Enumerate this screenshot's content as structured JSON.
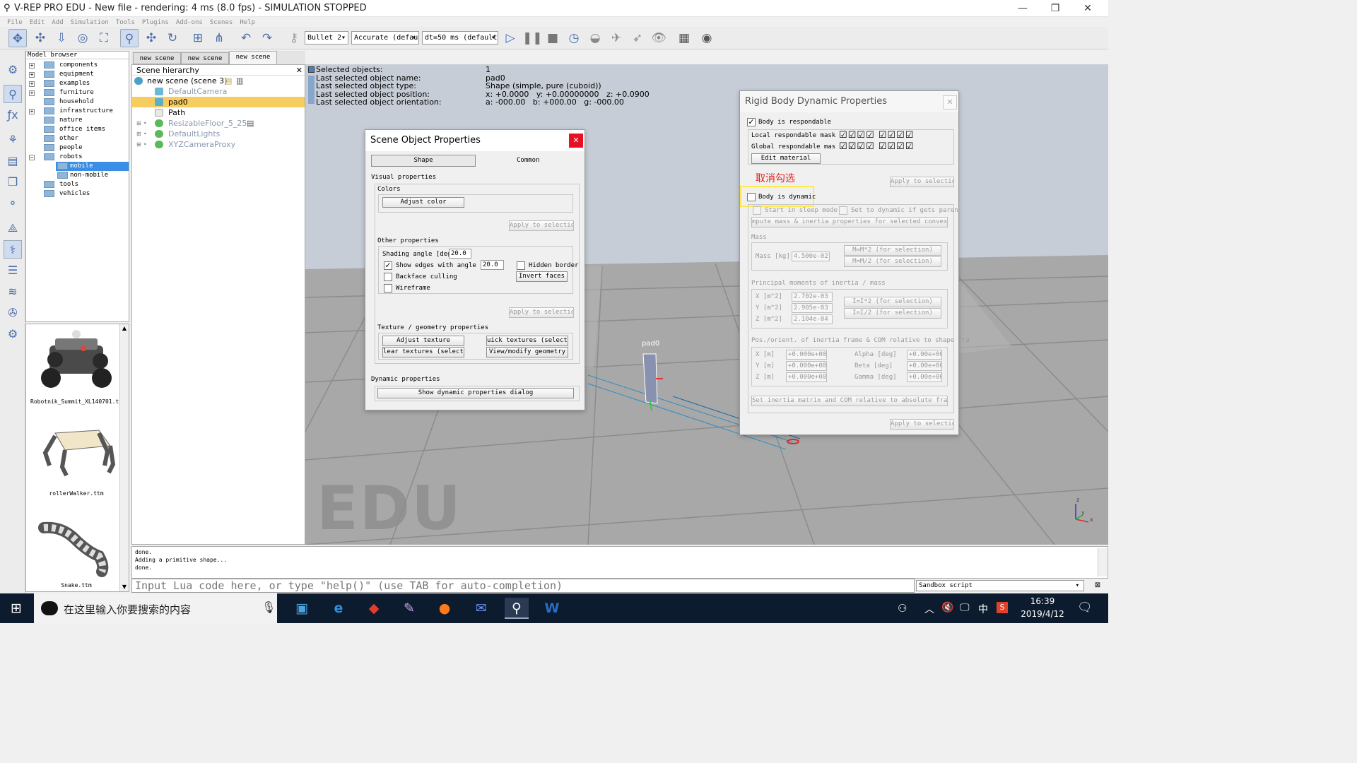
{
  "window": {
    "title": "V-REP PRO EDU - New file - rendering: 4 ms (8.0 fps) - SIMULATION STOPPED"
  },
  "menu": [
    "File",
    "Edit",
    "Add",
    "Simulation",
    "Tools",
    "Plugins",
    "Add-ons",
    "Scenes",
    "Help"
  ],
  "toolbar": {
    "engine": "Bullet 2",
    "accuracy": "Accurate (defau",
    "timestep": "dt=50 ms (default"
  },
  "model_browser": {
    "header": "Model browser",
    "items": [
      "components",
      "equipment",
      "examples",
      "furniture",
      "household",
      "infrastructure",
      "nature",
      "office items",
      "other",
      "people",
      "robots",
      "mobile",
      "non-mobile",
      "tools",
      "vehicles"
    ],
    "thumbnails": [
      "Robotnik_Summit_XL140701.ttm",
      "rollerWalker.ttm",
      "Snake.ttm"
    ]
  },
  "scene_tabs": [
    "new scene",
    "new scene",
    "new scene"
  ],
  "hierarchy": {
    "header": "Scene hierarchy",
    "root": "new scene (scene 3)",
    "items": [
      "DefaultCamera",
      "pad0",
      "Path",
      "ResizableFloor_5_25",
      "DefaultLights",
      "XYZCameraProxy"
    ]
  },
  "info": {
    "labels": [
      "Selected objects:",
      "Last selected object name:",
      "Last selected object type:",
      "Last selected object position:",
      "Last selected object orientation:"
    ],
    "values": [
      "1",
      "pad0",
      "Shape (simple, pure (cuboid))",
      "x: +0.0000   y: +0.00000000   z: +0.0900",
      "a: -000.00   b: +000.00   g: -000.00"
    ]
  },
  "viewport": {
    "watermark": "EDU",
    "object_label": "pad0",
    "axis_z": "z",
    "axis_x": "x",
    "axis_y": "y"
  },
  "sop": {
    "title": "Scene Object Properties",
    "tab_shape": "Shape",
    "tab_common": "Common",
    "visual_title": "Visual properties",
    "colors": "Colors",
    "adjust_color": "Adjust color",
    "apply1": "Apply to selection",
    "other_title": "Other properties",
    "shading_label": "Shading angle [deg]",
    "shading_value": "20.0",
    "show_edges": "Show edges with angle [de",
    "edges_value": "20.0",
    "hidden_border": "Hidden border",
    "backface": "Backface culling",
    "invert_faces": "Invert faces",
    "wireframe": "Wireframe",
    "apply2": "Apply to selection",
    "texture_title": "Texture / geometry properties",
    "adjust_texture": "Adjust texture",
    "quick_textures": "uick textures (selection",
    "clear_textures": "lear textures (selection",
    "view_geometry": "View/modify geometry",
    "dynamic_title": "Dynamic properties",
    "show_dynamic": "Show dynamic properties dialog"
  },
  "rbd": {
    "title": "Rigid Body Dynamic Properties",
    "respondable": "Body is respondable",
    "local_mask": "Local respondable mask",
    "global_mask": "Global respondable mas",
    "edit_material": "Edit material",
    "annotation": "取消勾选",
    "apply_top": "Apply to selection",
    "dynamic": "Body is dynamic",
    "sleep": "Start in sleep mode",
    "set_dynamic": "Set to dynamic if gets paren",
    "compute": "mpute mass & inertia properties for selected convex shap",
    "mass_title": "Mass",
    "mass_label": "Mass [kg]",
    "mass_value": "4.500e-02",
    "mass_x2": "M=M*2  (for selection)",
    "mass_d2": "M=M/2  (for selection)",
    "inertia_title": "Principal moments of inertia / mass",
    "ix": "X [m^2]",
    "iy": "Y [m^2]",
    "iz": "Z [m^2]",
    "ixv": "2.702e-03",
    "iyv": "2.905e-03",
    "izv": "2.104e-04",
    "i_x2": "I=I*2  (for selection)",
    "i_d2": "I=I/2  (for selection)",
    "pos_title": "Pos./orient. of inertia frame & COM relative to shape fra",
    "px": "X [m]",
    "py": "Y [m]",
    "pz": "Z [m]",
    "pxv": "+0.000e+00",
    "pyv": "+0.000e+00",
    "pzv": "+0.000e+00",
    "alpha": "Alpha [deg]",
    "beta": "Beta [deg]",
    "gamma": "Gamma [deg]",
    "av": "+0.00e+00",
    "bv": "+0.00e+00",
    "gv": "+0.00e+00",
    "set_inertia": "Set inertia matrix and COM relative to absolute frame",
    "apply_bottom": "Apply to selection"
  },
  "console": [
    "done.",
    "Adding a primitive shape...",
    "done."
  ],
  "lua": {
    "placeholder": "Input Lua code here, or type \"help()\" (use TAB for auto-completion)"
  },
  "sandbox": "Sandbox script",
  "taskbar": {
    "search": "在这里输入你要搜索的内容",
    "time": "16:39",
    "date": "2019/4/12",
    "ime": "中"
  },
  "colors": {
    "accent": "#f7cd5f",
    "highlight": "#ffe94d",
    "annotation": "#e8211e",
    "taskbar": "#0c1c2e"
  }
}
